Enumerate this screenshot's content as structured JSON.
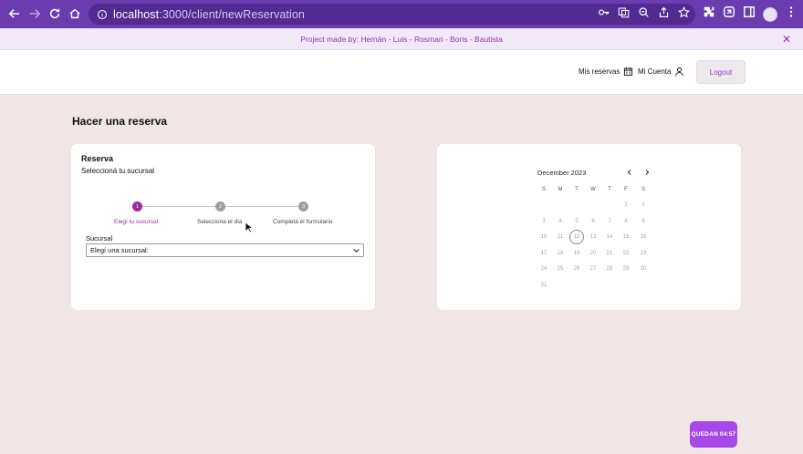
{
  "browser": {
    "url_host": "localhost",
    "url_rest": ":3000/client/newReservation"
  },
  "banner": {
    "text": "Project made by: Hernán - Luis - Rosmari - Boris - Bautista",
    "close": "✕"
  },
  "header": {
    "mis_reservas": "Mis reservas",
    "mi_cuenta": "Mi Cuenta",
    "logout": "Logout"
  },
  "page": {
    "title": "Hacer una reserva"
  },
  "reserva": {
    "title": "Reserva",
    "subtitle": "Seleccioná tu sucursal",
    "steps": [
      {
        "num": "1",
        "label": "Elegí tu sucursal"
      },
      {
        "num": "2",
        "label": "Selecciona el día"
      },
      {
        "num": "3",
        "label": "Completá el formulario"
      }
    ],
    "field_label": "Sucursal",
    "select_value": "Elegí una sucursal:"
  },
  "calendar": {
    "month": "December 2023",
    "weekdays": [
      "S",
      "M",
      "T",
      "W",
      "T",
      "F",
      "S"
    ],
    "weeks": [
      [
        "",
        "",
        "",
        "",
        "",
        "1",
        "2"
      ],
      [
        "3",
        "4",
        "5",
        "6",
        "7",
        "8",
        "9"
      ],
      [
        "10",
        "11",
        "12",
        "13",
        "14",
        "15",
        "16"
      ],
      [
        "17",
        "18",
        "19",
        "20",
        "21",
        "22",
        "23"
      ],
      [
        "24",
        "25",
        "26",
        "27",
        "28",
        "29",
        "30"
      ],
      [
        "31",
        "",
        "",
        "",
        "",
        "",
        ""
      ]
    ],
    "today": "12"
  },
  "timer": {
    "text": "QUEDAN 04:57"
  },
  "colors": {
    "accent": "#9c2aa4",
    "chrome": "#6a3cb0",
    "timer": "#a848e8"
  }
}
